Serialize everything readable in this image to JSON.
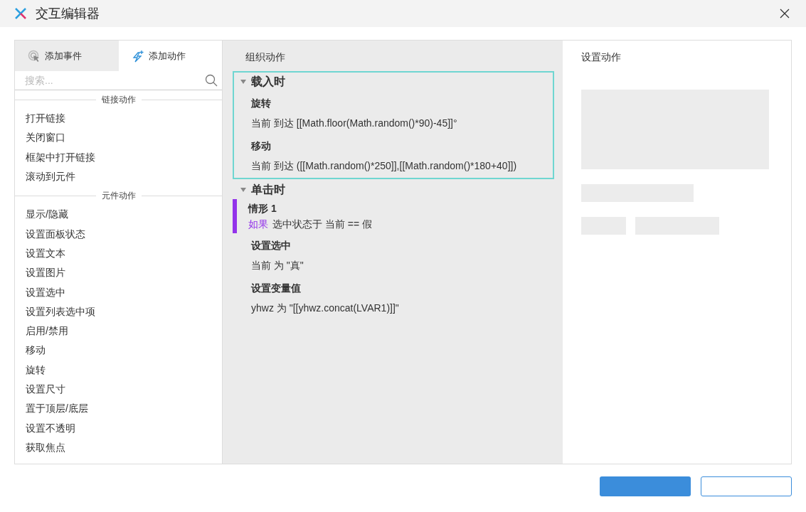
{
  "window": {
    "title": "交互编辑器"
  },
  "tabs": [
    {
      "label": "添加事件",
      "selected": false,
      "kind": "event"
    },
    {
      "label": "添加动作",
      "selected": true,
      "kind": "action"
    }
  ],
  "search": {
    "placeholder": "搜索..."
  },
  "action_groups": [
    {
      "heading": "链接动作",
      "items": [
        "打开链接",
        "关闭窗口",
        "框架中打开链接",
        "滚动到元件"
      ]
    },
    {
      "heading": "元件动作",
      "items": [
        "显示/隐藏",
        "设置面板状态",
        "设置文本",
        "设置图片",
        "设置选中",
        "设置列表选中项",
        "启用/禁用",
        "移动",
        "旋转",
        "设置尺寸",
        "置于顶层/底层",
        "设置不透明",
        "获取焦点"
      ]
    }
  ],
  "organize": {
    "title": "组织动作",
    "events": [
      {
        "name": "载入时",
        "expanded": true,
        "selected": true,
        "items": [
          {
            "kind": "action",
            "title": "旋转",
            "detail": "当前 到达 [[Math.floor(Math.random()*90)-45]]°"
          },
          {
            "kind": "action",
            "title": "移动",
            "detail": "当前 到达 ([[Math.random()*250]],[[Math.random()*180+40]])"
          }
        ]
      },
      {
        "name": "单击时",
        "expanded": true,
        "selected": false,
        "items": [
          {
            "kind": "case",
            "title": "情形 1",
            "keyword": "如果",
            "condition": "选中状态于 当前 == 假",
            "color": "#9333ea"
          },
          {
            "kind": "action",
            "title": "设置选中",
            "detail": "当前 为 \"真\""
          },
          {
            "kind": "action",
            "title": "设置变量值",
            "detail": "yhwz 为 \"[[yhwz.concat(LVAR1)]]\""
          }
        ]
      }
    ]
  },
  "settings": {
    "title": "设置动作"
  },
  "buttons": [
    {
      "kind": "primary"
    },
    {
      "kind": "secondary"
    }
  ]
}
